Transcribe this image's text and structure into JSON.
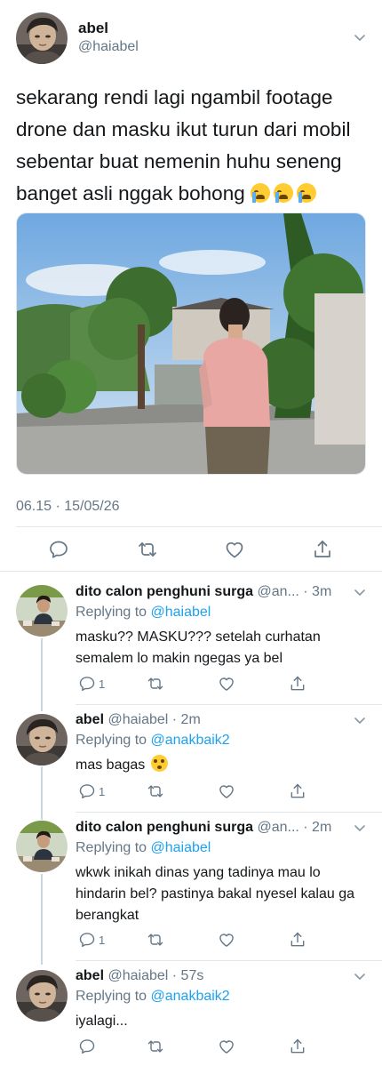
{
  "main_tweet": {
    "display_name": "abel",
    "handle": "@haiabel",
    "text": "sekarang rendi lagi ngambil footage drone dan masku ikut turun dari mobil sebentar buat nemenin huhu seneng banget asli nggak bohong",
    "emojis": [
      "loudly-crying-face",
      "loudly-crying-face",
      "loudly-crying-face"
    ],
    "timestamp": "06.15 · 15/05/26"
  },
  "replies": [
    {
      "display_name": "dito calon penghuni surga",
      "handle": "@an...",
      "time": "· 3m",
      "replying_prefix": "Replying to",
      "replying_to": "@haiabel",
      "text": "masku?? MASKU??? setelah curhatan semalem lo makin ngegas ya bel",
      "reply_count": "1"
    },
    {
      "display_name": "abel",
      "handle": "@haiabel",
      "time": "· 2m",
      "replying_prefix": "Replying to",
      "replying_to": "@anakbaik2",
      "text": "mas bagas",
      "emoji": "flushed-face",
      "reply_count": "1"
    },
    {
      "display_name": "dito calon penghuni surga",
      "handle": "@an...",
      "time": "· 2m",
      "replying_prefix": "Replying to",
      "replying_to": "@haiabel",
      "text": "wkwk inikah dinas yang tadinya mau lo hindarin bel? pastinya bakal nyesel kalau ga berangkat",
      "reply_count": "1"
    },
    {
      "display_name": "abel",
      "handle": "@haiabel",
      "time": "· 57s",
      "replying_prefix": "Replying to",
      "replying_to": "@anakbaik2",
      "text": "iyalagi...",
      "reply_count": ""
    }
  ],
  "colors": {
    "link": "#1da1f2",
    "secondary_text": "#657786",
    "primary_text": "#14171a",
    "divider": "#e1e8ed",
    "thread_line": "#ccd6dd"
  }
}
